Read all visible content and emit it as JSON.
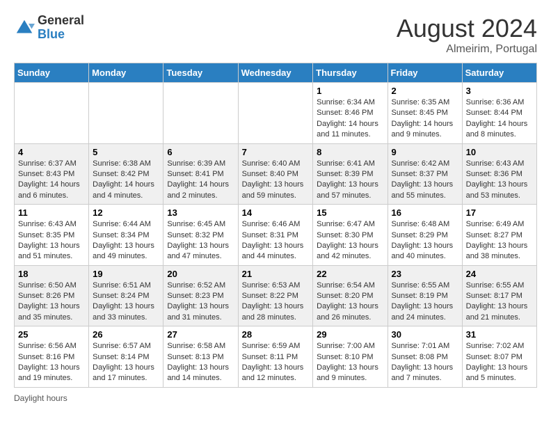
{
  "header": {
    "logo_general": "General",
    "logo_blue": "Blue",
    "month_year": "August 2024",
    "location": "Almeirim, Portugal"
  },
  "footer": {
    "daylight_label": "Daylight hours"
  },
  "days_of_week": [
    "Sunday",
    "Monday",
    "Tuesday",
    "Wednesday",
    "Thursday",
    "Friday",
    "Saturday"
  ],
  "weeks": [
    [
      {
        "day": "",
        "info": ""
      },
      {
        "day": "",
        "info": ""
      },
      {
        "day": "",
        "info": ""
      },
      {
        "day": "",
        "info": ""
      },
      {
        "day": "1",
        "info": "Sunrise: 6:34 AM\nSunset: 8:46 PM\nDaylight: 14 hours and 11 minutes."
      },
      {
        "day": "2",
        "info": "Sunrise: 6:35 AM\nSunset: 8:45 PM\nDaylight: 14 hours and 9 minutes."
      },
      {
        "day": "3",
        "info": "Sunrise: 6:36 AM\nSunset: 8:44 PM\nDaylight: 14 hours and 8 minutes."
      }
    ],
    [
      {
        "day": "4",
        "info": "Sunrise: 6:37 AM\nSunset: 8:43 PM\nDaylight: 14 hours and 6 minutes."
      },
      {
        "day": "5",
        "info": "Sunrise: 6:38 AM\nSunset: 8:42 PM\nDaylight: 14 hours and 4 minutes."
      },
      {
        "day": "6",
        "info": "Sunrise: 6:39 AM\nSunset: 8:41 PM\nDaylight: 14 hours and 2 minutes."
      },
      {
        "day": "7",
        "info": "Sunrise: 6:40 AM\nSunset: 8:40 PM\nDaylight: 13 hours and 59 minutes."
      },
      {
        "day": "8",
        "info": "Sunrise: 6:41 AM\nSunset: 8:39 PM\nDaylight: 13 hours and 57 minutes."
      },
      {
        "day": "9",
        "info": "Sunrise: 6:42 AM\nSunset: 8:37 PM\nDaylight: 13 hours and 55 minutes."
      },
      {
        "day": "10",
        "info": "Sunrise: 6:43 AM\nSunset: 8:36 PM\nDaylight: 13 hours and 53 minutes."
      }
    ],
    [
      {
        "day": "11",
        "info": "Sunrise: 6:43 AM\nSunset: 8:35 PM\nDaylight: 13 hours and 51 minutes."
      },
      {
        "day": "12",
        "info": "Sunrise: 6:44 AM\nSunset: 8:34 PM\nDaylight: 13 hours and 49 minutes."
      },
      {
        "day": "13",
        "info": "Sunrise: 6:45 AM\nSunset: 8:32 PM\nDaylight: 13 hours and 47 minutes."
      },
      {
        "day": "14",
        "info": "Sunrise: 6:46 AM\nSunset: 8:31 PM\nDaylight: 13 hours and 44 minutes."
      },
      {
        "day": "15",
        "info": "Sunrise: 6:47 AM\nSunset: 8:30 PM\nDaylight: 13 hours and 42 minutes."
      },
      {
        "day": "16",
        "info": "Sunrise: 6:48 AM\nSunset: 8:29 PM\nDaylight: 13 hours and 40 minutes."
      },
      {
        "day": "17",
        "info": "Sunrise: 6:49 AM\nSunset: 8:27 PM\nDaylight: 13 hours and 38 minutes."
      }
    ],
    [
      {
        "day": "18",
        "info": "Sunrise: 6:50 AM\nSunset: 8:26 PM\nDaylight: 13 hours and 35 minutes."
      },
      {
        "day": "19",
        "info": "Sunrise: 6:51 AM\nSunset: 8:24 PM\nDaylight: 13 hours and 33 minutes."
      },
      {
        "day": "20",
        "info": "Sunrise: 6:52 AM\nSunset: 8:23 PM\nDaylight: 13 hours and 31 minutes."
      },
      {
        "day": "21",
        "info": "Sunrise: 6:53 AM\nSunset: 8:22 PM\nDaylight: 13 hours and 28 minutes."
      },
      {
        "day": "22",
        "info": "Sunrise: 6:54 AM\nSunset: 8:20 PM\nDaylight: 13 hours and 26 minutes."
      },
      {
        "day": "23",
        "info": "Sunrise: 6:55 AM\nSunset: 8:19 PM\nDaylight: 13 hours and 24 minutes."
      },
      {
        "day": "24",
        "info": "Sunrise: 6:55 AM\nSunset: 8:17 PM\nDaylight: 13 hours and 21 minutes."
      }
    ],
    [
      {
        "day": "25",
        "info": "Sunrise: 6:56 AM\nSunset: 8:16 PM\nDaylight: 13 hours and 19 minutes."
      },
      {
        "day": "26",
        "info": "Sunrise: 6:57 AM\nSunset: 8:14 PM\nDaylight: 13 hours and 17 minutes."
      },
      {
        "day": "27",
        "info": "Sunrise: 6:58 AM\nSunset: 8:13 PM\nDaylight: 13 hours and 14 minutes."
      },
      {
        "day": "28",
        "info": "Sunrise: 6:59 AM\nSunset: 8:11 PM\nDaylight: 13 hours and 12 minutes."
      },
      {
        "day": "29",
        "info": "Sunrise: 7:00 AM\nSunset: 8:10 PM\nDaylight: 13 hours and 9 minutes."
      },
      {
        "day": "30",
        "info": "Sunrise: 7:01 AM\nSunset: 8:08 PM\nDaylight: 13 hours and 7 minutes."
      },
      {
        "day": "31",
        "info": "Sunrise: 7:02 AM\nSunset: 8:07 PM\nDaylight: 13 hours and 5 minutes."
      }
    ]
  ]
}
